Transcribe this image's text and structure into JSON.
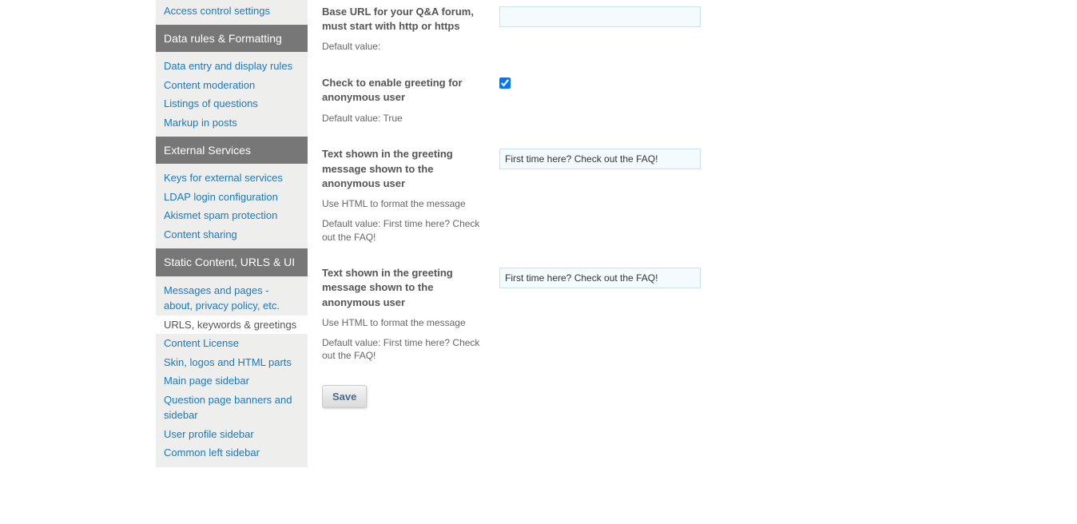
{
  "sidebar": {
    "toplink": "Access control settings",
    "sections": [
      {
        "title": "Data rules & Formatting",
        "items": [
          {
            "label": "Data entry and display rules",
            "active": false
          },
          {
            "label": "Content moderation",
            "active": false
          },
          {
            "label": "Listings of questions",
            "active": false
          },
          {
            "label": "Markup in posts",
            "active": false
          }
        ]
      },
      {
        "title": "External Services",
        "items": [
          {
            "label": "Keys for external services",
            "active": false
          },
          {
            "label": "LDAP login configuration",
            "active": false
          },
          {
            "label": "Akismet spam protection",
            "active": false
          },
          {
            "label": "Content sharing",
            "active": false
          }
        ]
      },
      {
        "title": "Static Content, URLS & UI",
        "items": [
          {
            "label": "Messages and pages - about, privacy policy, etc.",
            "active": false
          },
          {
            "label": "URLS, keywords & greetings",
            "active": true
          },
          {
            "label": "Content License",
            "active": false
          },
          {
            "label": "Skin, logos and HTML parts",
            "active": false
          },
          {
            "label": "Main page sidebar",
            "active": false
          },
          {
            "label": "Question page banners and sidebar",
            "active": false
          },
          {
            "label": "User profile sidebar",
            "active": false
          },
          {
            "label": "Common left sidebar",
            "active": false
          }
        ]
      }
    ]
  },
  "settings": [
    {
      "label": "Base URL for your Q&A forum, must start with http or https",
      "help": "",
      "defaultText": "Default value:",
      "type": "text",
      "value": ""
    },
    {
      "label": "Check to enable greeting for anonymous user",
      "help": "",
      "defaultText": "Default value: True",
      "type": "checkbox",
      "checked": true
    },
    {
      "label": "Text shown in the greeting message shown to the anonymous user",
      "help": "Use HTML to format the message",
      "defaultText": "Default value: First time here? Check out the FAQ!",
      "type": "text",
      "value": "First time here? Check out the FAQ!"
    },
    {
      "label": "Text shown in the greeting message shown to the anonymous user",
      "help": "Use HTML to format the message",
      "defaultText": "Default value: First time here? Check out the FAQ!",
      "type": "text",
      "value": "First time here? Check out the FAQ!"
    }
  ],
  "save_label": "Save"
}
